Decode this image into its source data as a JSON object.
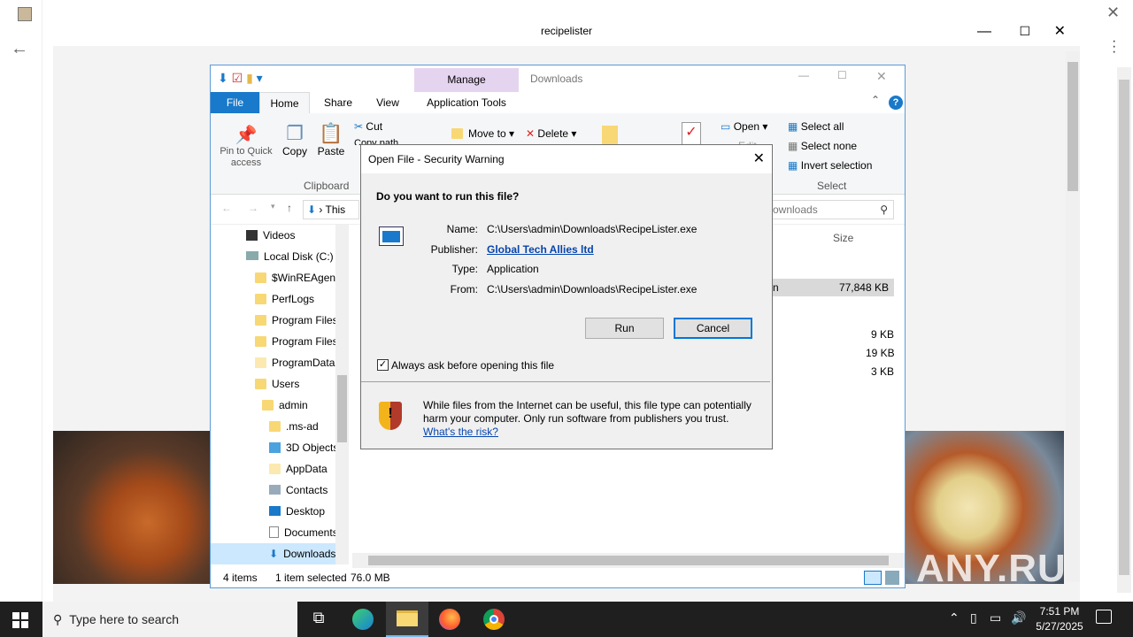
{
  "browser": {
    "title": "recipelister",
    "back_icon": "back-arrow-icon",
    "close_icon": "close-icon",
    "menu_icon": "menu-dots-icon"
  },
  "watermark": "ANY.RUN",
  "explorer": {
    "title": "Downloads",
    "manage_label": "Manage",
    "tabs": [
      "File",
      "Home",
      "Share",
      "View",
      "Application Tools"
    ],
    "ribbon": {
      "pin": "Pin to Quick access",
      "copy": "Copy",
      "paste": "Paste",
      "clipboard": "Clipboard",
      "cut": "Cut",
      "copy_path": "Copy path",
      "move_to": "Move to",
      "delete": "Delete",
      "open": "Open",
      "edit": "Edit",
      "select_all": "Select all",
      "select_none": "Select none",
      "invert": "Invert selection",
      "select": "Select"
    },
    "address": "This",
    "search_placeholder": "ownloads",
    "nav": [
      "Videos",
      "Local Disk (C:)",
      "$WinREAgent",
      "PerfLogs",
      "Program Files",
      "Program Files",
      "ProgramData",
      "Users",
      "admin",
      ".ms-ad",
      "3D Objects",
      "AppData",
      "Contacts",
      "Desktop",
      "Documents",
      "Downloads"
    ],
    "size_header": "Size",
    "sizes": [
      "77,848 KB",
      "9 KB",
      "19 KB",
      "3 KB"
    ],
    "row_partial": "n",
    "status": {
      "items": "4 items",
      "selected": "1 item selected",
      "size": "76.0 MB"
    }
  },
  "dialog": {
    "title": "Open File - Security Warning",
    "question": "Do you want to run this file?",
    "name_label": "Name:",
    "name": "C:\\Users\\admin\\Downloads\\RecipeLister.exe",
    "publisher_label": "Publisher:",
    "publisher": "Global Tech Allies ltd",
    "type_label": "Type:",
    "type": "Application",
    "from_label": "From:",
    "from": "C:\\Users\\admin\\Downloads\\RecipeLister.exe",
    "run": "Run",
    "cancel": "Cancel",
    "always_ask": "Always ask before opening this file",
    "warning": "While files from the Internet can be useful, this file type can potentially harm your computer. Only run software from publishers you trust.",
    "risk_link": "What's the risk?"
  },
  "taskbar": {
    "search": "Type here to search",
    "time": "7:51 PM",
    "date": "5/27/2025"
  }
}
